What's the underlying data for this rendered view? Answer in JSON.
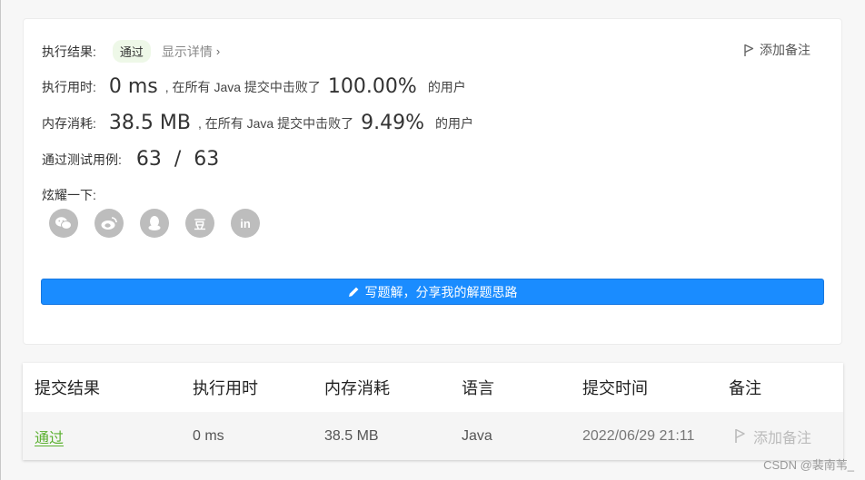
{
  "result": {
    "label": "执行结果:",
    "status": "通过",
    "show_details": "显示详情",
    "add_note": "添加备注"
  },
  "runtime": {
    "label": "执行用时:",
    "value": "0 ms",
    "mid_text": ", 在所有 Java 提交中击败了",
    "percent": "100.00%",
    "suffix": "的用户"
  },
  "memory": {
    "label": "内存消耗:",
    "value": "38.5 MB",
    "mid_text": ", 在所有 Java 提交中击败了",
    "percent": "9.49%",
    "suffix": "的用户"
  },
  "tests": {
    "label": "通过测试用例:",
    "value": "63  /  63"
  },
  "share": {
    "label": "炫耀一下:",
    "icons": [
      "wechat-icon",
      "weibo-icon",
      "qq-icon",
      "douban-icon",
      "linkedin-icon"
    ],
    "douban_glyph": "豆",
    "linkedin_glyph": "in"
  },
  "solution_button": "写题解，分享我的解题思路",
  "table": {
    "headers": [
      "提交结果",
      "执行用时",
      "内存消耗",
      "语言",
      "提交时间",
      "备注"
    ],
    "rows": [
      [
        "通过",
        "0 ms",
        "38.5 MB",
        "Java",
        "2022/06/29 21:11",
        "添加备注"
      ]
    ]
  },
  "watermark": "CSDN @裴南苇_",
  "colors": {
    "accent_blue": "#1a8cff",
    "success_green": "#5bb030",
    "badge_bg": "#eef8e8"
  }
}
